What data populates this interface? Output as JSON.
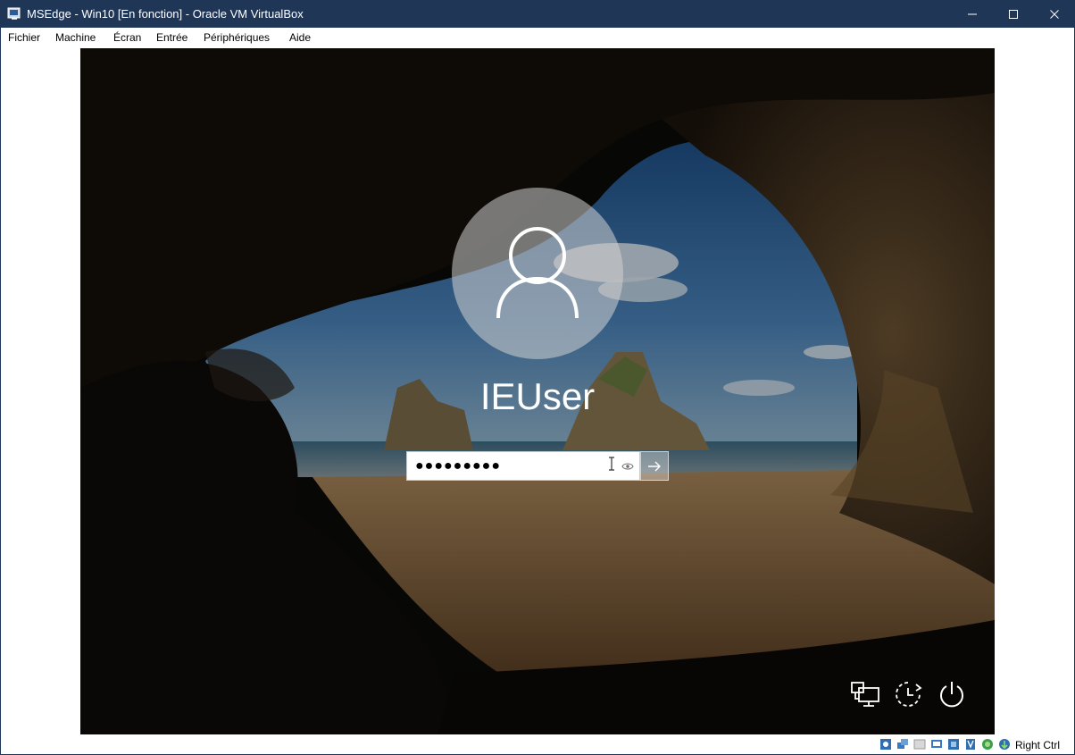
{
  "window": {
    "title": "MSEdge - Win10 [En fonction] - Oracle VM VirtualBox",
    "controls": [
      "minimize",
      "maximize",
      "close"
    ]
  },
  "menu": {
    "items": [
      "Fichier",
      "Machine",
      "Écran",
      "Entrée",
      "Périphériques",
      "Aide"
    ]
  },
  "login": {
    "username": "IEUser",
    "password_masked": "●●●●●●●●●",
    "avatar_icon": "user-silhouette-icon",
    "reveal_icon": "eye-icon",
    "submit_icon": "arrow-right-icon"
  },
  "corner_icons": [
    "network-icon",
    "ease-of-access-icon",
    "power-icon"
  ],
  "statusbar": {
    "icons": [
      "optical-drive-icon",
      "network-adapters-icon",
      "shared-folders-icon",
      "display-icon",
      "usb-icon",
      "video-capture-icon",
      "guest-additions-icon",
      "mouse-integration-icon",
      "host-key-icon"
    ],
    "host_key": "Right Ctrl"
  },
  "colors": {
    "titlebar": "#1f3657",
    "vm_background": "#0a0a0a",
    "sky": "#3a6fa8",
    "sand": "#9a7447"
  }
}
